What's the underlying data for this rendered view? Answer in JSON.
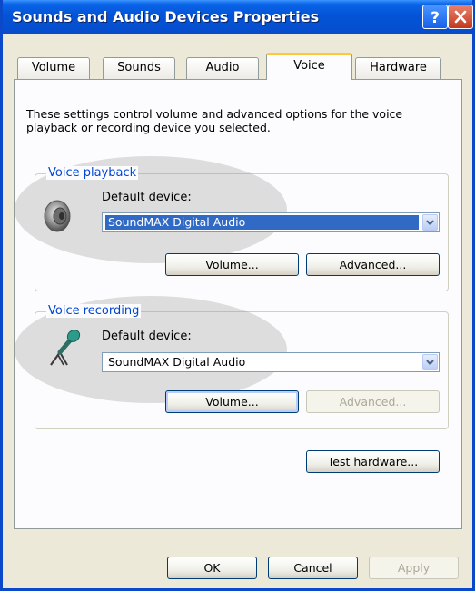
{
  "window": {
    "title": "Sounds and Audio Devices Properties",
    "buttons": {
      "help": "?",
      "close": "X"
    }
  },
  "tabs": [
    {
      "label": "Volume",
      "active": false
    },
    {
      "label": "Sounds",
      "active": false
    },
    {
      "label": "Audio",
      "active": false
    },
    {
      "label": "Voice",
      "active": true
    },
    {
      "label": "Hardware",
      "active": false
    }
  ],
  "description": "These settings control volume and advanced options for the voice playback or recording device you selected.",
  "playback": {
    "group_title": "Voice playback",
    "device_label": "Default device:",
    "selected_device": "SoundMAX Digital Audio",
    "volume_button": "Volume...",
    "advanced_button": "Advanced..."
  },
  "recording": {
    "group_title": "Voice recording",
    "device_label": "Default device:",
    "selected_device": "SoundMAX Digital Audio",
    "volume_button": "Volume...",
    "advanced_button": "Advanced..."
  },
  "test_hardware_button": "Test hardware...",
  "footer": {
    "ok": "OK",
    "cancel": "Cancel",
    "apply": "Apply"
  },
  "icons": {
    "playback": "speaker-icon",
    "recording": "microphone-icon",
    "dropdown": "chevron-down-icon"
  },
  "colors": {
    "titlebar": "#0453d6",
    "group_title": "#0046d5",
    "selection": "#316ac5",
    "active_tab_accent": "#ffc83c"
  }
}
